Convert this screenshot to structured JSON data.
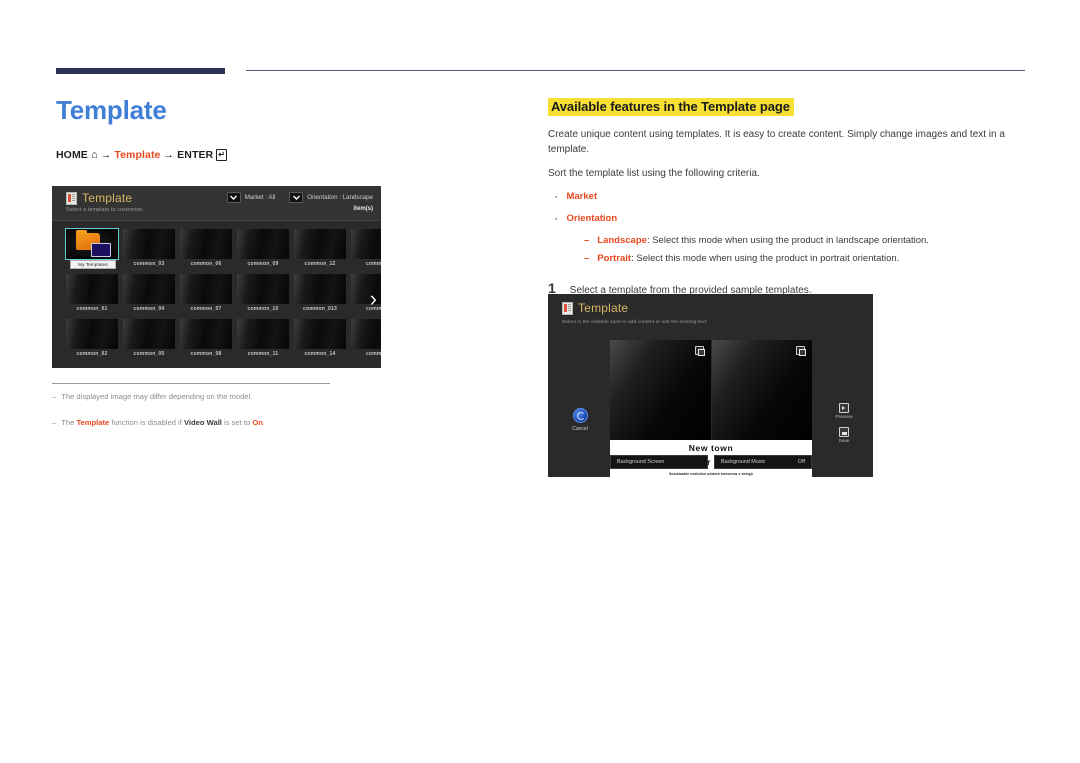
{
  "left": {
    "heading": "Template",
    "nav": {
      "home": "HOME",
      "home_icon": "home-icon",
      "arrow1": "→",
      "target": "Template",
      "arrow2": "→",
      "enter": "ENTER",
      "enter_icon": "enter-key-icon"
    },
    "screenshot": {
      "title": "Template",
      "subtitle": "Select a template to customise.",
      "filters": [
        {
          "icon": "chevron-down-icon",
          "label": "Market : All"
        },
        {
          "icon": "chevron-down-icon",
          "label": "Orientation : Landscape"
        }
      ],
      "items_count": "item(s)",
      "next_arrow": "›",
      "grid": [
        {
          "label": "My Templates",
          "selected": true
        },
        {
          "label": "common_03",
          "selected": false
        },
        {
          "label": "common_06",
          "selected": false
        },
        {
          "label": "common_09",
          "selected": false
        },
        {
          "label": "common_12",
          "selected": false
        },
        {
          "label": "common",
          "selected": false
        },
        {
          "label": "common_01",
          "selected": false
        },
        {
          "label": "common_04",
          "selected": false
        },
        {
          "label": "common_07",
          "selected": false
        },
        {
          "label": "common_10",
          "selected": false
        },
        {
          "label": "common_013",
          "selected": false
        },
        {
          "label": "common",
          "selected": false
        },
        {
          "label": "common_02",
          "selected": false
        },
        {
          "label": "common_05",
          "selected": false
        },
        {
          "label": "common_08",
          "selected": false
        },
        {
          "label": "common_11",
          "selected": false
        },
        {
          "label": "common_14",
          "selected": false
        },
        {
          "label": "common",
          "selected": false
        }
      ]
    },
    "footnotes": [
      {
        "dash": "–",
        "parts": [
          {
            "text": "The displayed image may differ depending on the model.",
            "style": "plain"
          }
        ]
      },
      {
        "dash": "–",
        "parts": [
          {
            "text": "The ",
            "style": "plain"
          },
          {
            "text": "Template",
            "style": "red"
          },
          {
            "text": " function is disabled if ",
            "style": "plain"
          },
          {
            "text": "Video Wall",
            "style": "dark"
          },
          {
            "text": " is set to ",
            "style": "plain"
          },
          {
            "text": "On",
            "style": "red"
          },
          {
            "text": ".",
            "style": "plain"
          }
        ]
      }
    ]
  },
  "right": {
    "heading": "Available features in the Template page",
    "para1": "Create unique content using templates. It is easy to create content. Simply change images and text in a template.",
    "para2": "Sort the template list using the following criteria.",
    "bullets": [
      {
        "dot": "▪",
        "label": "Market"
      },
      {
        "dot": "▪",
        "label": "Orientation"
      }
    ],
    "subbullets": [
      {
        "dash": "–",
        "term": "Landscape",
        "desc": ": Select this mode when using the product in landscape orientation."
      },
      {
        "dash": "–",
        "term": "Portrait",
        "desc": ": Select this mode when using the product in portrait orientation."
      }
    ],
    "step": {
      "number": "1",
      "text": "Select a template from the provided sample templates."
    },
    "screenshot": {
      "title": "Template",
      "subtitle": "Select in the editable zone to add content or edit the existing text.",
      "card": {
        "line1": "New town",
        "line2": "interior design",
        "line3": "Sustainable evolution unlatch tomorrow s design"
      },
      "cancel": {
        "icon": "cancel-icon",
        "label": "Cancel"
      },
      "side_buttons": [
        {
          "icon": "preview-icon",
          "label": "Preview"
        },
        {
          "icon": "save-icon",
          "label": "Save"
        }
      ],
      "bottom_bar": [
        {
          "label": "Background Screen",
          "value": ""
        },
        {
          "label": "Background Music",
          "value": "Off"
        }
      ],
      "pane_icon": "image-placeholder-icon"
    }
  },
  "colors": {
    "heading_blue": "#3f7fd8",
    "accent_red": "#e8491e",
    "highlight_yellow": "#f7e033",
    "rule_navy": "#2e3256",
    "ui_gold": "#d8b765",
    "selection_teal": "#5fd0cf"
  }
}
